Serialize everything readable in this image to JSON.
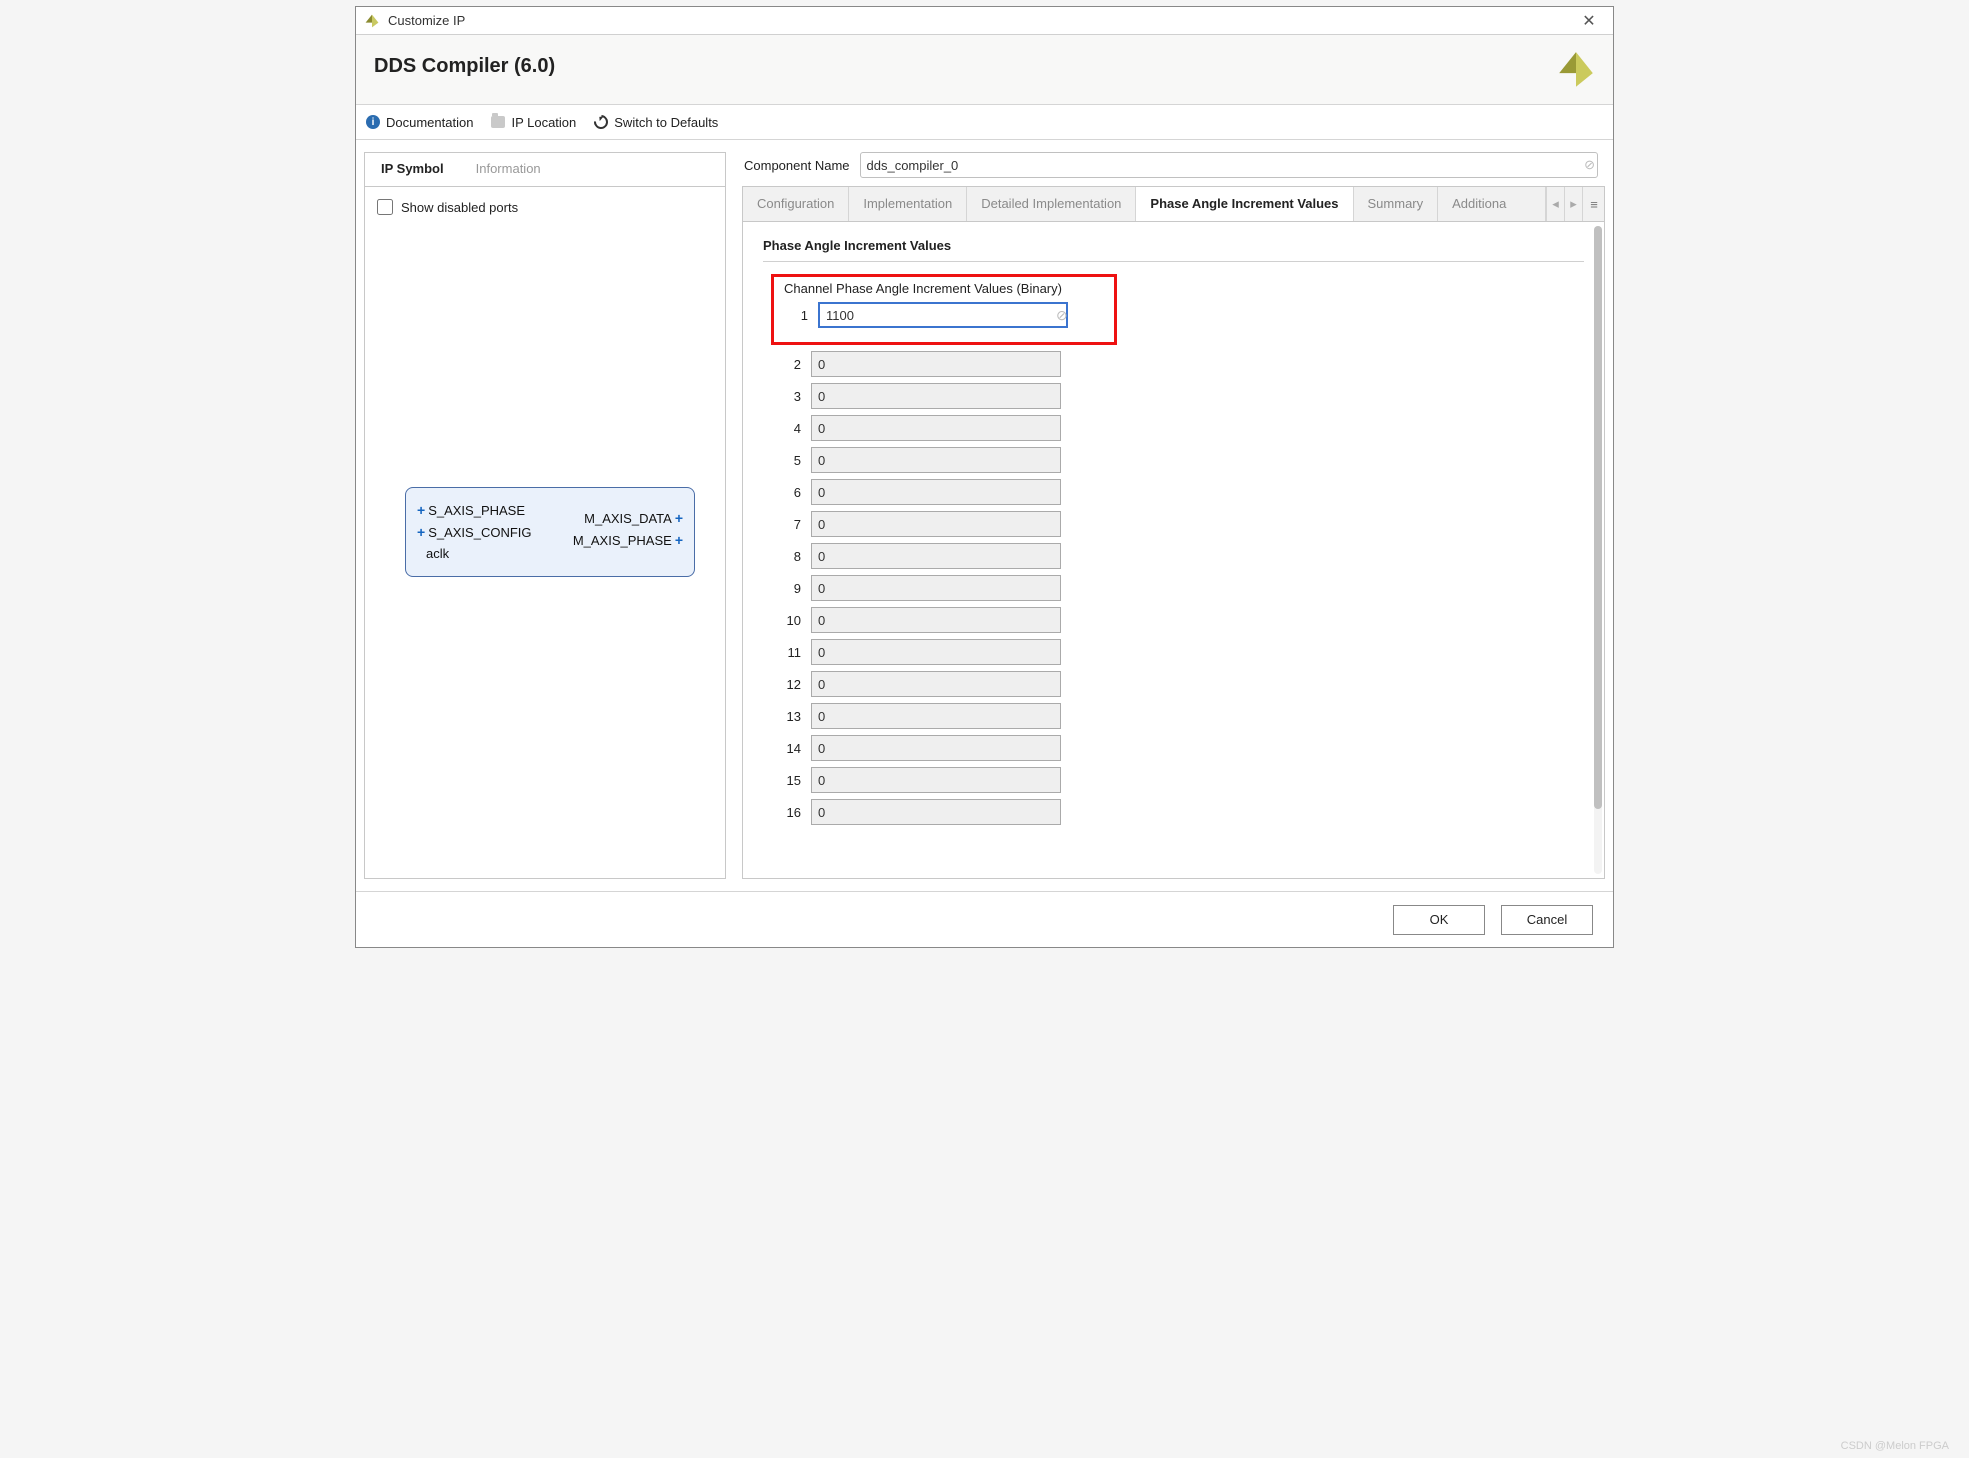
{
  "window": {
    "title": "Customize IP"
  },
  "header": {
    "title": "DDS Compiler (6.0)"
  },
  "toolbar": {
    "documentation": "Documentation",
    "ip_location": "IP Location",
    "switch_defaults": "Switch to Defaults"
  },
  "left": {
    "tabs": {
      "symbol": "IP Symbol",
      "information": "Information"
    },
    "show_disabled_ports": "Show disabled ports",
    "ports": {
      "s_axis_phase": "S_AXIS_PHASE",
      "s_axis_config": "S_AXIS_CONFIG",
      "aclk": "aclk",
      "m_axis_data": "M_AXIS_DATA",
      "m_axis_phase": "M_AXIS_PHASE"
    }
  },
  "component_name": {
    "label": "Component Name",
    "value": "dds_compiler_0"
  },
  "tabs": {
    "configuration": "Configuration",
    "implementation": "Implementation",
    "detailed_implementation": "Detailed Implementation",
    "phase_angle": "Phase Angle Increment Values",
    "summary": "Summary",
    "additional": "Additiona"
  },
  "content": {
    "section_title": "Phase Angle Increment Values",
    "group_title": "Channel Phase Angle Increment Values (Binary)",
    "rows": [
      {
        "idx": "1",
        "val": "1100"
      },
      {
        "idx": "2",
        "val": "0"
      },
      {
        "idx": "3",
        "val": "0"
      },
      {
        "idx": "4",
        "val": "0"
      },
      {
        "idx": "5",
        "val": "0"
      },
      {
        "idx": "6",
        "val": "0"
      },
      {
        "idx": "7",
        "val": "0"
      },
      {
        "idx": "8",
        "val": "0"
      },
      {
        "idx": "9",
        "val": "0"
      },
      {
        "idx": "10",
        "val": "0"
      },
      {
        "idx": "11",
        "val": "0"
      },
      {
        "idx": "12",
        "val": "0"
      },
      {
        "idx": "13",
        "val": "0"
      },
      {
        "idx": "14",
        "val": "0"
      },
      {
        "idx": "15",
        "val": "0"
      },
      {
        "idx": "16",
        "val": "0"
      }
    ]
  },
  "footer": {
    "ok": "OK",
    "cancel": "Cancel"
  },
  "watermark": "CSDN @Melon FPGA"
}
